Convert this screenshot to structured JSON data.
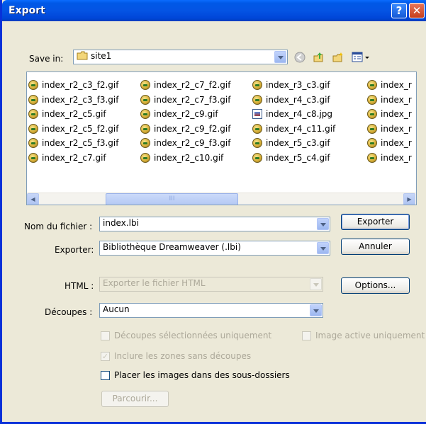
{
  "window": {
    "title": "Export",
    "help_glyph": "?",
    "close_glyph": "✕"
  },
  "save_in": {
    "label": "Save in:",
    "folder": "site1"
  },
  "files": {
    "columns": [
      [
        {
          "name": "index_r2_c3_f2.gif",
          "icon": "gif"
        },
        {
          "name": "index_r2_c3_f3.gif",
          "icon": "gif"
        },
        {
          "name": "index_r2_c5.gif",
          "icon": "gif"
        },
        {
          "name": "index_r2_c5_f2.gif",
          "icon": "gif"
        },
        {
          "name": "index_r2_c5_f3.gif",
          "icon": "gif"
        },
        {
          "name": "index_r2_c7.gif",
          "icon": "gif"
        }
      ],
      [
        {
          "name": "index_r2_c7_f2.gif",
          "icon": "gif"
        },
        {
          "name": "index_r2_c7_f3.gif",
          "icon": "gif"
        },
        {
          "name": "index_r2_c9.gif",
          "icon": "gif"
        },
        {
          "name": "index_r2_c9_f2.gif",
          "icon": "gif"
        },
        {
          "name": "index_r2_c9_f3.gif",
          "icon": "gif"
        },
        {
          "name": "index_r2_c10.gif",
          "icon": "gif"
        }
      ],
      [
        {
          "name": "index_r3_c3.gif",
          "icon": "gif"
        },
        {
          "name": "index_r4_c3.gif",
          "icon": "gif"
        },
        {
          "name": "index_r4_c8.jpg",
          "icon": "jpg"
        },
        {
          "name": "index_r4_c11.gif",
          "icon": "gif"
        },
        {
          "name": "index_r5_c3.gif",
          "icon": "gif"
        },
        {
          "name": "index_r5_c4.gif",
          "icon": "gif"
        }
      ],
      [
        {
          "name": "index_r",
          "icon": "gif"
        },
        {
          "name": "index_r",
          "icon": "gif"
        },
        {
          "name": "index_r",
          "icon": "gif"
        },
        {
          "name": "index_r",
          "icon": "gif"
        },
        {
          "name": "index_r",
          "icon": "gif"
        },
        {
          "name": "index_r",
          "icon": "gif"
        }
      ]
    ],
    "scroll_thumb_grip": "III",
    "scroll_left": "◀",
    "scroll_right": "▶"
  },
  "filename": {
    "label": "Nom du fichier :",
    "value": "index.lbi"
  },
  "export_type": {
    "label": "Exporter:",
    "value": "Bibliothèque Dreamweaver (.lbi)"
  },
  "html": {
    "label": "HTML :",
    "value": "Exporter le fichier HTML"
  },
  "slices": {
    "label": "Découpes :",
    "value": "Aucun"
  },
  "buttons": {
    "export": "Exporter",
    "cancel": "Annuler",
    "options": "Options...",
    "browse": "Parcourir..."
  },
  "checks": {
    "selected_slices": {
      "label": "Découpes sélectionnées uniquement",
      "checked": false
    },
    "active_image": {
      "label": "Image active uniquement",
      "checked": false
    },
    "include_areas": {
      "label": "Inclure les zones sans découpes",
      "checked": true
    },
    "subfolders": {
      "label": "Placer les images dans des sous-dossiers",
      "checked": false
    }
  },
  "colors": {
    "titlebar": "#0054e3",
    "dialog_bg": "#ece9d8",
    "accent_border": "#0831d9"
  },
  "icons": [
    "back-icon",
    "up-folder-icon",
    "new-folder-icon",
    "view-menu-icon",
    "folder-icon"
  ]
}
